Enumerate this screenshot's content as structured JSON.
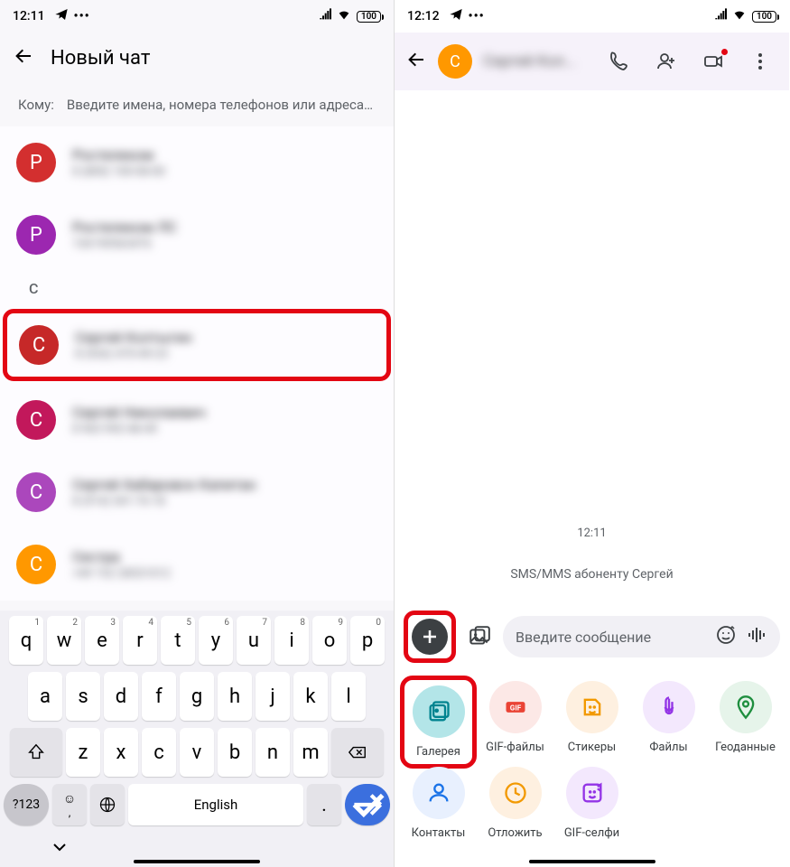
{
  "left": {
    "status": {
      "time": "12:11",
      "battery": "100"
    },
    "header": {
      "title": "Новый чат"
    },
    "to": {
      "label": "Кому:",
      "placeholder": "Введите имена, номера телефонов или адреса ..."
    },
    "contacts": [
      {
        "letter": "Р",
        "name": "Ростелеком",
        "sub": "8 (800) 100-08-00",
        "avatarClass": "red1"
      },
      {
        "letter": "Р",
        "name": "Ростелеком ЛС",
        "sub": "136190563476",
        "avatarClass": "purple"
      }
    ],
    "section": "С",
    "contacts_c": [
      {
        "letter": "С",
        "name": "Сергей Колтыгин",
        "sub": "8 (926) 470-49-23",
        "avatarClass": "red2",
        "highlighted": true
      },
      {
        "letter": "С",
        "name": "Сергей Николаевич",
        "sub": "8 963 992-48-49",
        "avatarClass": "magenta"
      },
      {
        "letter": "С",
        "name": "Сергей Хабаровск Капитан",
        "sub": "8 (914) 541-76-18",
        "avatarClass": "purple2"
      },
      {
        "letter": "С",
        "name": "Сестра",
        "sub": "+49 152 28531012",
        "avatarClass": "orange"
      }
    ],
    "keyboard": {
      "row1": [
        "q",
        "w",
        "e",
        "r",
        "t",
        "y",
        "u",
        "i",
        "o",
        "p"
      ],
      "sup1": [
        "1",
        "2",
        "3",
        "4",
        "5",
        "6",
        "7",
        "8",
        "9",
        "0"
      ],
      "row2": [
        "a",
        "s",
        "d",
        "f",
        "g",
        "h",
        "j",
        "k",
        "l"
      ],
      "row3": [
        "z",
        "x",
        "c",
        "v",
        "b",
        "n",
        "m"
      ],
      "num": "?123",
      "space": "English"
    }
  },
  "right": {
    "status": {
      "time": "12:12",
      "battery": "100"
    },
    "header": {
      "avatar": "С",
      "name": "Сергей Кол..."
    },
    "chat": {
      "time": "12:11",
      "note": "SMS/MMS абоненту Сергей"
    },
    "compose": {
      "placeholder": "Введите сообщение"
    },
    "attachments": [
      {
        "label": "Галерея",
        "circleClass": "c-teal",
        "highlighted": true
      },
      {
        "label": "GIF-файлы",
        "circleClass": "c-red"
      },
      {
        "label": "Стикеры",
        "circleClass": "c-orange"
      },
      {
        "label": "Файлы",
        "circleClass": "c-purple"
      },
      {
        "label": "Геоданные",
        "circleClass": "c-green"
      },
      {
        "label": "Контакты",
        "circleClass": "c-blue"
      },
      {
        "label": "Отложить",
        "circleClass": "c-orange2"
      },
      {
        "label": "GIF-селфи",
        "circleClass": "c-purple2"
      }
    ]
  }
}
